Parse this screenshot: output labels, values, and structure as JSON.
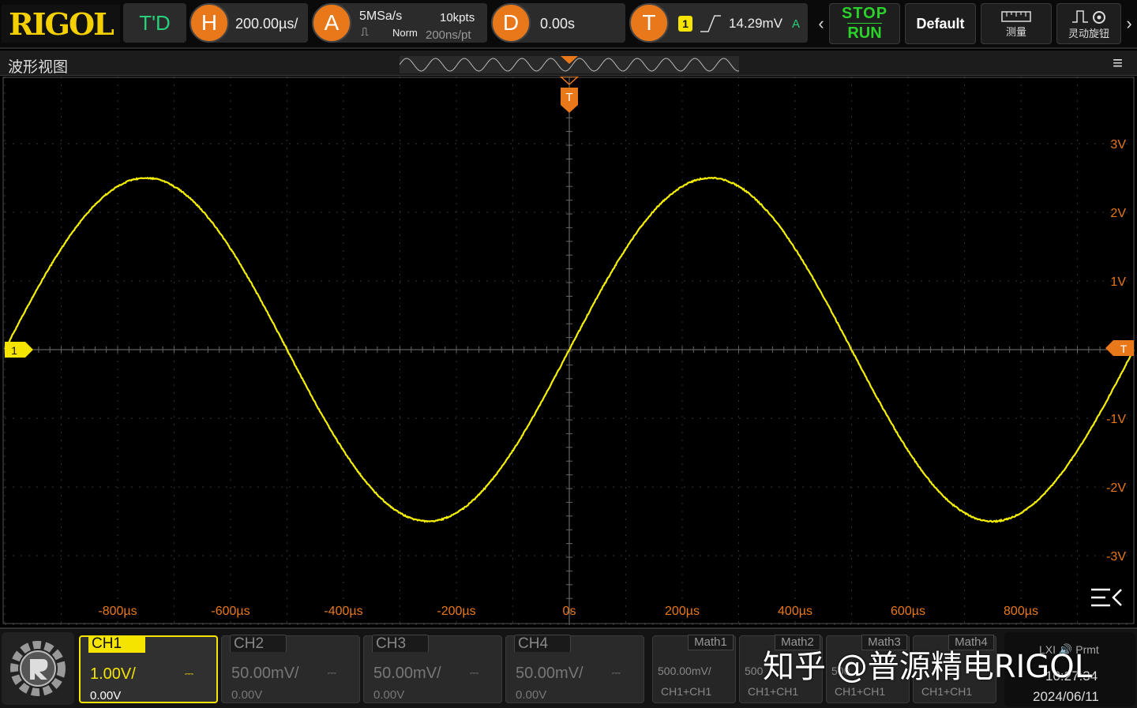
{
  "brand": "RIGOL",
  "toolbar": {
    "td_label": "T'D",
    "horizontal": {
      "letter": "H",
      "timebase": "200.00µs/"
    },
    "acquire": {
      "letter": "A",
      "sample_rate": "5MSa/s",
      "depth": "10kpts",
      "mode": "Norm",
      "per_point": "200ns/pt"
    },
    "delay": {
      "letter": "D",
      "value": "0.00s"
    },
    "trigger": {
      "letter": "T",
      "source": "1",
      "level": "14.29mV",
      "mode": "A"
    },
    "stop_label": "STOP",
    "run_label": "RUN",
    "default_label": "Default",
    "measure_label": "测量",
    "knob_label": "灵动旋钮"
  },
  "view": {
    "title": "波形视图",
    "trigger_marker": "T",
    "channel_marker": "1",
    "trigger_level_marker": "T",
    "y_labels": [
      "3V",
      "2V",
      "1V",
      "-1V",
      "-2V",
      "-3V"
    ],
    "x_labels": [
      "-800µs",
      "-600µs",
      "-400µs",
      "-200µs",
      "0s",
      "200µs",
      "400µs",
      "600µs",
      "800µs"
    ]
  },
  "trace": {
    "color": "#f5f000",
    "amplitude_v": 2.5,
    "period_us": 1000,
    "phase_zero_us": 0,
    "time_span_us": [
      -1000,
      1000
    ],
    "volt_span": [
      -4,
      4
    ]
  },
  "channels": [
    {
      "name": "CH1",
      "scale": "1.00V/",
      "offset": "0.00V",
      "active": true
    },
    {
      "name": "CH2",
      "scale": "50.00mV/",
      "offset": "0.00V",
      "active": false
    },
    {
      "name": "CH3",
      "scale": "50.00mV/",
      "offset": "0.00V",
      "active": false
    },
    {
      "name": "CH4",
      "scale": "50.00mV/",
      "offset": "0.00V",
      "active": false
    }
  ],
  "maths": [
    {
      "name": "Math1",
      "scale": "500.00mV/",
      "source": "CH1+CH1"
    },
    {
      "name": "Math2",
      "scale": "500",
      "source": "CH1+CH1"
    },
    {
      "name": "Math3",
      "scale": "500",
      "source": "CH1+CH1"
    },
    {
      "name": "Math4",
      "scale": "",
      "source": "CH1+CH1"
    }
  ],
  "status": {
    "time": "10:27:34",
    "date": "2024/06/11",
    "icons": "LXI 🔊 Prmt"
  },
  "watermark": "知乎 @普源精电RIGOL"
}
